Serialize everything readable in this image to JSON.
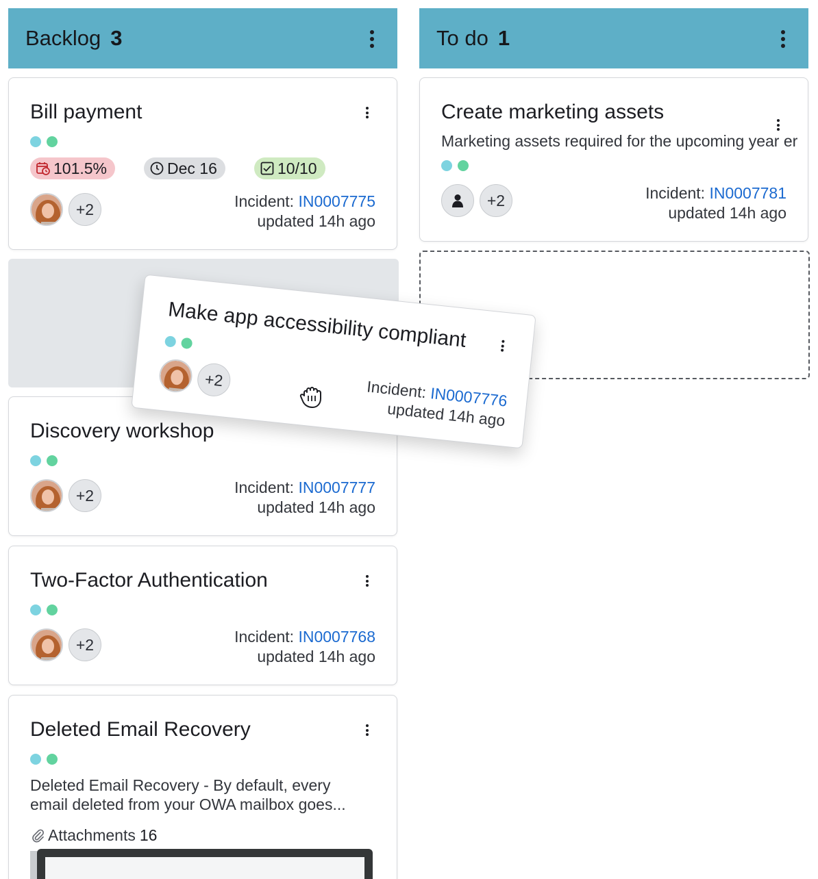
{
  "columns": [
    {
      "title": "Backlog",
      "count": "3"
    },
    {
      "title": "To do",
      "count": "1"
    }
  ],
  "cards": {
    "bill_payment": {
      "title": "Bill payment",
      "badges": {
        "progress": "101.5%",
        "due": "Dec 16",
        "checklist": "10/10"
      },
      "plus": "+2",
      "incident_label": "Incident:",
      "incident_id": "IN0007775",
      "updated": "updated 14h ago"
    },
    "create_marketing": {
      "title": "Create marketing assets",
      "description": "Marketing assets required for the upcoming year er",
      "plus": "+2",
      "incident_label": "Incident:",
      "incident_id": "IN0007781",
      "updated": "updated 14h ago"
    },
    "make_app": {
      "title": "Make app accessibility compliant",
      "plus": "+2",
      "incident_label": "Incident:",
      "incident_id": "IN0007776",
      "updated": "updated 14h ago"
    },
    "discovery": {
      "title": "Discovery workshop",
      "plus": "+2",
      "incident_label": "Incident:",
      "incident_id": "IN0007777",
      "updated": "updated 14h ago"
    },
    "two_factor": {
      "title": "Two-Factor Authentication",
      "plus": "+2",
      "incident_label": "Incident:",
      "incident_id": "IN0007768",
      "updated": "updated 14h ago"
    },
    "deleted_email": {
      "title": "Deleted Email Recovery",
      "description_line1": "Deleted Email Recovery - By default, every",
      "description_line2": "email deleted from your OWA mailbox goes...",
      "attachments_label": "Attachments",
      "attachments_count": "16"
    }
  },
  "colors": {
    "header": "#5eafc7",
    "dot_cyan": "#7dd3e0",
    "dot_green": "#62d39f",
    "link": "#1b6ad0",
    "badge_red": "#f5c6cb",
    "badge_gray": "#dcdee1",
    "badge_green": "#cfeac1"
  },
  "icons": [
    "more-vertical-icon",
    "calendar-clock-icon",
    "clock-icon",
    "checkbox-icon",
    "user-icon",
    "paperclip-icon",
    "grab-hand-icon"
  ]
}
